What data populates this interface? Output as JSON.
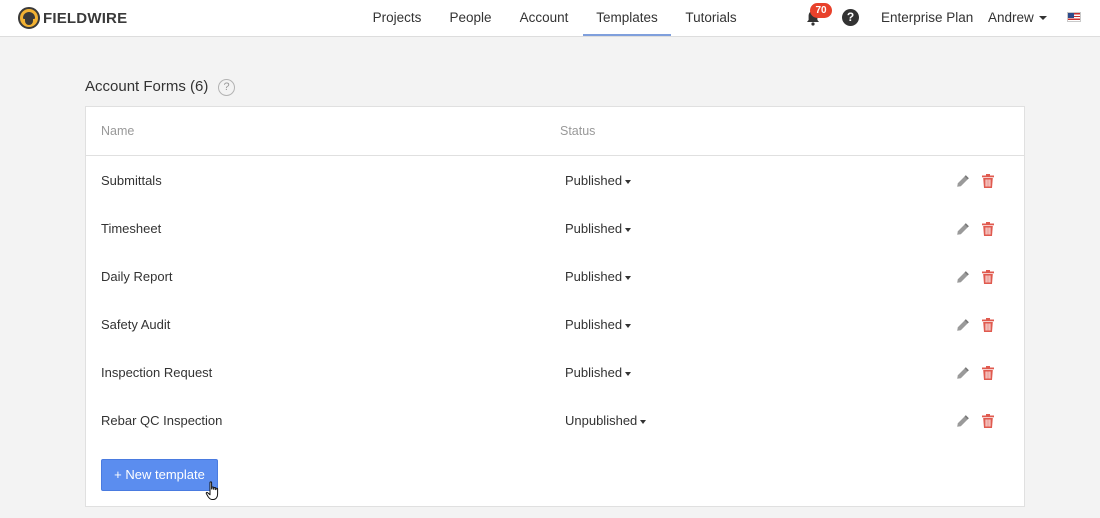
{
  "header": {
    "logo_text": "FIELDWIRE",
    "nav": {
      "projects": "Projects",
      "people": "People",
      "account": "Account",
      "templates": "Templates",
      "tutorials": "Tutorials"
    },
    "active_tab": "Templates",
    "notification_count": "70",
    "help_symbol": "?",
    "plan": "Enterprise Plan",
    "user": "Andrew",
    "icons": [
      "bell-icon",
      "help-icon",
      "us-flag-icon"
    ]
  },
  "section": {
    "title": "Account Forms (6)",
    "help_symbol": "?"
  },
  "table": {
    "columns": {
      "name": "Name",
      "status": "Status"
    },
    "rows": [
      {
        "name": "Submittals",
        "status": "Published"
      },
      {
        "name": "Timesheet",
        "status": "Published"
      },
      {
        "name": "Daily Report",
        "status": "Published"
      },
      {
        "name": "Safety Audit",
        "status": "Published"
      },
      {
        "name": "Inspection Request",
        "status": "Published"
      },
      {
        "name": "Rebar QC Inspection",
        "status": "Unpublished"
      }
    ],
    "row_icons": [
      "pencil-icon",
      "trash-icon"
    ]
  },
  "new_template_label": "+ New template",
  "colors": {
    "primary_button": "#5b8def",
    "active_tab_underline": "#7f9fdc",
    "badge": "#e8412b",
    "delete_icon": "#e05a4f",
    "edit_icon": "#8a8a8a"
  }
}
